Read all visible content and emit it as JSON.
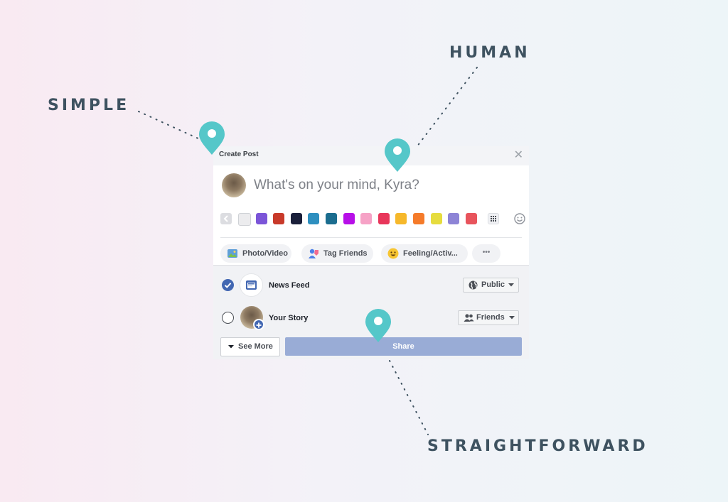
{
  "callouts": {
    "simple": "SIMPLE",
    "human": "HUMAN",
    "straightforward": "STRAIGHTFORWARD"
  },
  "colors": {
    "pin": "#55c7c9",
    "label": "#3e5260",
    "share_button": "#99acd6",
    "checkbox_checked": "#4267b2"
  },
  "dialog": {
    "title": "Create Post",
    "close_icon": "close-icon",
    "prompt": "What's on your mind, Kyra?",
    "background_swatches": [
      "#ececee",
      "#7b55d8",
      "#c83a2a",
      "#1a1f3a",
      "#2e8fbf",
      "#1b6d8f",
      "#b70fe8",
      "#f6a2c6",
      "#e8365a",
      "#f6b82b",
      "#f57b2a",
      "#e6dc3e",
      "#8d84d6",
      "#e8545c"
    ],
    "actions": [
      {
        "label": "Photo/Video",
        "icon": "photo-icon"
      },
      {
        "label": "Tag Friends",
        "icon": "tag-friends-icon"
      },
      {
        "label": "Feeling/Activ...",
        "icon": "feeling-icon"
      },
      {
        "label": "•••",
        "icon": "more-icon"
      }
    ],
    "destinations": [
      {
        "label": "News Feed",
        "checked": true,
        "privacy": "Public",
        "privacy_icon": "globe-icon"
      },
      {
        "label": "Your Story",
        "checked": false,
        "privacy": "Friends",
        "privacy_icon": "friends-icon"
      }
    ],
    "see_more": "See More",
    "share": "Share"
  }
}
